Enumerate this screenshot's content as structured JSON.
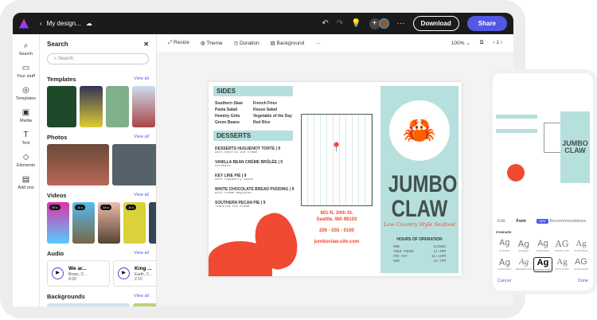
{
  "header": {
    "title": "My design...",
    "download": "Download",
    "share": "Share"
  },
  "rail": [
    {
      "icon": "search-icon",
      "label": "Search",
      "g": "⌕"
    },
    {
      "icon": "folder-icon",
      "label": "Your stuff",
      "g": "▭"
    },
    {
      "icon": "templates-icon",
      "label": "Templates",
      "g": "◎"
    },
    {
      "icon": "media-icon",
      "label": "Media",
      "g": "▣"
    },
    {
      "icon": "text-icon",
      "label": "Text",
      "g": "T"
    },
    {
      "icon": "elements-icon",
      "label": "Elements",
      "g": "◇"
    },
    {
      "icon": "addons-icon",
      "label": "Add ons",
      "g": "▤"
    }
  ],
  "panel": {
    "title": "Search",
    "search_placeholder": "Search",
    "view_all": "View all",
    "sections": {
      "templates": "Templates",
      "photos": "Photos",
      "videos": "Videos",
      "audio": "Audio",
      "backgrounds": "Backgrounds"
    },
    "videos": [
      "20 s",
      "11 s",
      "14 s",
      "11 s"
    ],
    "audio": [
      {
        "title": "We ar...",
        "artist": "Brass, C...",
        "duration": "4:20"
      },
      {
        "title": "King ...",
        "artist": "Earth, C...",
        "duration": "2:15"
      }
    ]
  },
  "toolbar": {
    "resize": "Resize",
    "theme": "Theme",
    "duration": "Duration",
    "background": "Background",
    "zoom": "100%",
    "page": "1"
  },
  "doc": {
    "sides_title": "SIDES",
    "sides": [
      "Southern Slaw",
      "French Fries",
      "Pasta Salad",
      "House Salad",
      "Hominy Grits",
      "Vegetable of the Day",
      "Green Beans",
      "Red Rice"
    ],
    "desserts_title": "DESSERTS",
    "desserts": [
      {
        "name": "DESSERTS HUGUENOT TORTE  |  9",
        "desc": "with vanilla ice cream"
      },
      {
        "name": "VANILLA BEAN CRÈME BRÛLÉE  |  9",
        "desc": "cordials"
      },
      {
        "name": "KEY LINE PIE  |  9",
        "desc": "with raspberry sauce"
      },
      {
        "name": "WHITE CHOCOLATE BREAD PUDDING  |  9",
        "desc": "with crème anglaise"
      },
      {
        "name": "SOUTHERN PECAN PIE  |  9",
        "desc": "+vanilla ice cream"
      }
    ],
    "address1": "801 N. 34th St.",
    "address2": "Seattle, WA 98103",
    "phone": "206 - 555 - 0100",
    "website": "jumboclaw.site.com",
    "name1": "JUMBO",
    "name2": "CLAW",
    "tagline": "Low Country Style Seafood",
    "hours_title": "HOURS OF OPERATION",
    "hours": [
      "MON",
      "CLOSED",
      "TUES-THURS",
      "11-9PM",
      "FRI-SAT",
      "11-11PM",
      "SUN",
      "12-7PM"
    ]
  },
  "phone": {
    "tabs": {
      "edit": "Edit",
      "font": "Font",
      "new": "NEW",
      "rec": "Recommendations"
    },
    "standard": "STANDARD",
    "fonts": [
      "PT MONO",
      "RALEWAY",
      "GRINSTEAD",
      "STENCIL STD",
      "STORYBOOK",
      "QUICKSAND",
      "SEAWEED SCR",
      "SOURCE SANS",
      "STINT ULTRA",
      "TRUE NORTH"
    ],
    "selected_font": "SOURCE SANS",
    "cancel": "Cancel",
    "done": "Done"
  },
  "colors": {
    "accent": "#5258e4",
    "coral": "#f04a32",
    "teal": "#b6e0dd"
  }
}
